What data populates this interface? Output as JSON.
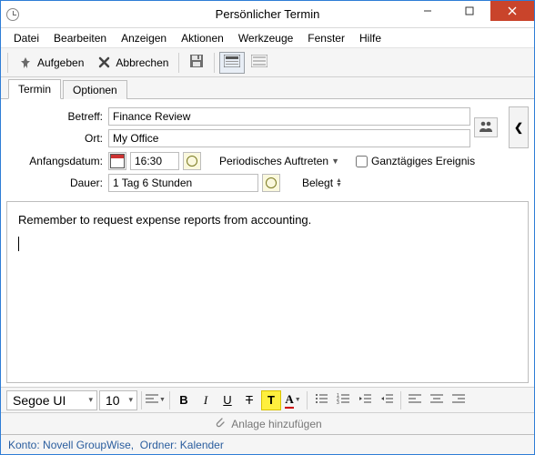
{
  "window": {
    "title": "Persönlicher Termin"
  },
  "menu": {
    "items": [
      "Datei",
      "Bearbeiten",
      "Anzeigen",
      "Aktionen",
      "Werkzeuge",
      "Fenster",
      "Hilfe"
    ]
  },
  "toolbar": {
    "post_label": "Aufgeben",
    "cancel_label": "Abbrechen"
  },
  "tabs": {
    "items": [
      "Termin",
      "Optionen"
    ],
    "active_index": 0
  },
  "fields": {
    "subject_label": "Betreff:",
    "subject_value": "Finance Review",
    "location_label": "Ort:",
    "location_value": "My Office",
    "startdate_label": "Anfangsdatum:",
    "time_value": "16:30",
    "recurrence_label": "Periodisches Auftreten",
    "allday_label": "Ganztägiges Ereignis",
    "allday_checked": false,
    "duration_label": "Dauer:",
    "duration_value": "1 Tag 6 Stunden",
    "busy_label": "Belegt"
  },
  "body": {
    "text": "Remember to request expense reports from accounting."
  },
  "format": {
    "font": "Segoe UI",
    "size": "10"
  },
  "attach": {
    "label": "Anlage hinzufügen"
  },
  "status": {
    "account_label": "Konto:",
    "account_value": "Novell GroupWise",
    "folder_label": "Ordner:",
    "folder_value": "Kalender"
  }
}
